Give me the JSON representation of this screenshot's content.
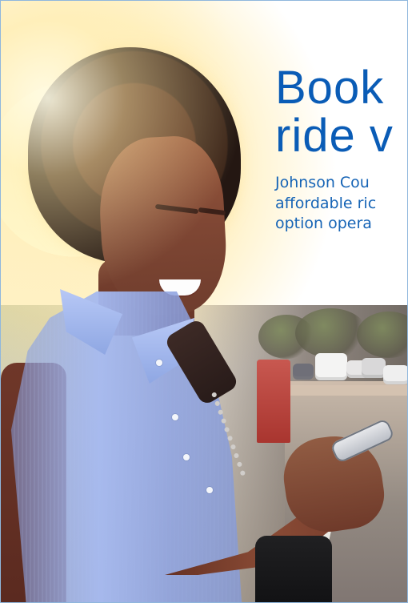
{
  "headline": {
    "line1": "Book",
    "line2": "ride v"
  },
  "subtext": {
    "line1": "Johnson Cou",
    "line2": "affordable ric",
    "line3": "option opera"
  },
  "image": {
    "description": "hero photo"
  },
  "colors": {
    "brand_blue": "#0a5cb6",
    "border_blue": "#8fb7dd"
  }
}
